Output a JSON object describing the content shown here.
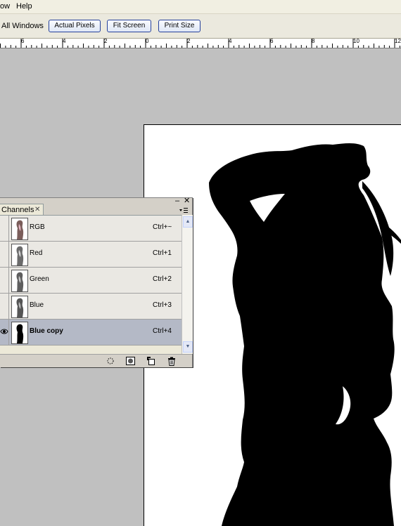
{
  "menubar": {
    "items": [
      {
        "label": "ow"
      },
      {
        "label": "Help"
      }
    ]
  },
  "options_bar": {
    "all_windows_label": "All Windows",
    "buttons": [
      {
        "label": "Actual Pixels"
      },
      {
        "label": "Fit Screen"
      },
      {
        "label": "Print Size"
      }
    ]
  },
  "ruler": {
    "labels": [
      "6",
      "4",
      "2",
      "0",
      "2",
      "4",
      "6",
      "8",
      "10",
      "12"
    ]
  },
  "channels_panel": {
    "tab_label": "Channels",
    "close_glyph": "✕",
    "min_glyph": "–",
    "panel_close_glyph": "✕",
    "rows": [
      {
        "name": "RGB",
        "shortcut": "Ctrl+~",
        "selected": false
      },
      {
        "name": "Red",
        "shortcut": "Ctrl+1",
        "selected": false
      },
      {
        "name": "Green",
        "shortcut": "Ctrl+2",
        "selected": false
      },
      {
        "name": "Blue",
        "shortcut": "Ctrl+3",
        "selected": false
      },
      {
        "name": "Blue copy",
        "shortcut": "Ctrl+4",
        "selected": true
      }
    ],
    "bottom_icons": [
      "load-selection-icon",
      "save-selection-icon",
      "new-channel-icon",
      "delete-channel-icon"
    ]
  },
  "colors": {
    "selected_row": "#b4b9c6",
    "button_border": "#26419b",
    "canvas_background": "#c0c0c0"
  }
}
